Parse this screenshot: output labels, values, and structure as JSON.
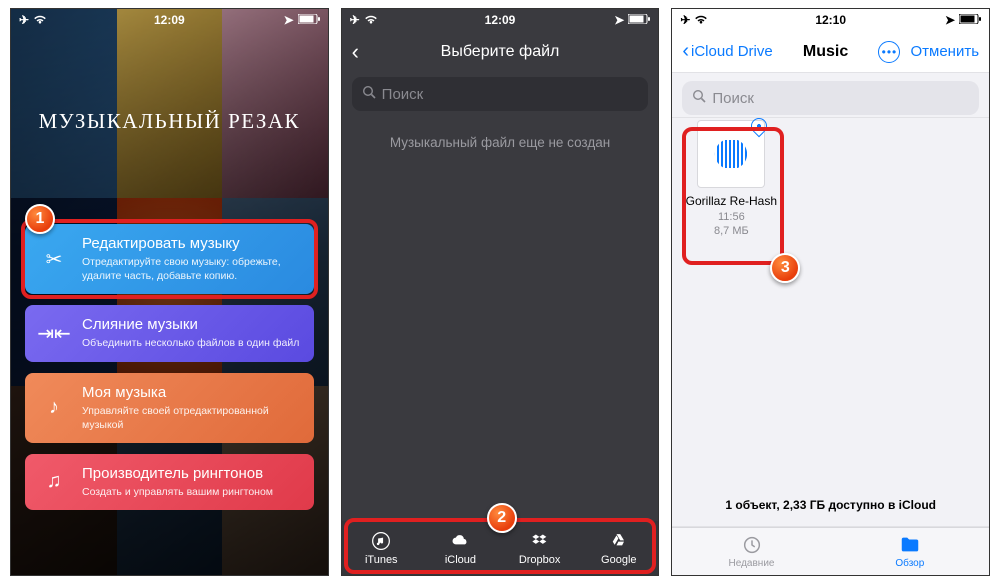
{
  "statusbar": {
    "time_a": "12:09",
    "time_b": "12:09",
    "time_c": "12:10"
  },
  "screen1": {
    "app_title": "МУЗЫКАЛЬНЫЙ РЕЗАК",
    "cards": [
      {
        "title": "Редактировать музыку",
        "sub": "Отредактируйте свою музыку: обрежьте, удалите часть, добавьте копию."
      },
      {
        "title": "Слияние музыки",
        "sub": "Объединить несколько файлов в один файл"
      },
      {
        "title": "Моя музыка",
        "sub": "Управляйте своей отредактированной музыкой"
      },
      {
        "title": "Производитель рингтонов",
        "sub": "Создать и управлять вашим рингтоном"
      }
    ]
  },
  "screen2": {
    "nav_title": "Выберите файл",
    "search_placeholder": "Поиск",
    "empty_text": "Музыкальный файл еще не создан",
    "sources": [
      "iTunes",
      "iCloud",
      "Dropbox",
      "Google"
    ]
  },
  "screen3": {
    "back_label": "iCloud Drive",
    "title": "Music",
    "cancel": "Отменить",
    "search_placeholder": "Поиск",
    "file": {
      "name": "Gorillaz Re-Hash",
      "time": "11:56",
      "size": "8,7 МБ"
    },
    "status": "1 объект, 2,33 ГБ доступно в iCloud",
    "tabs": {
      "recent": "Недавние",
      "browse": "Обзор"
    }
  },
  "badges": {
    "b1": "1",
    "b2": "2",
    "b3": "3"
  }
}
